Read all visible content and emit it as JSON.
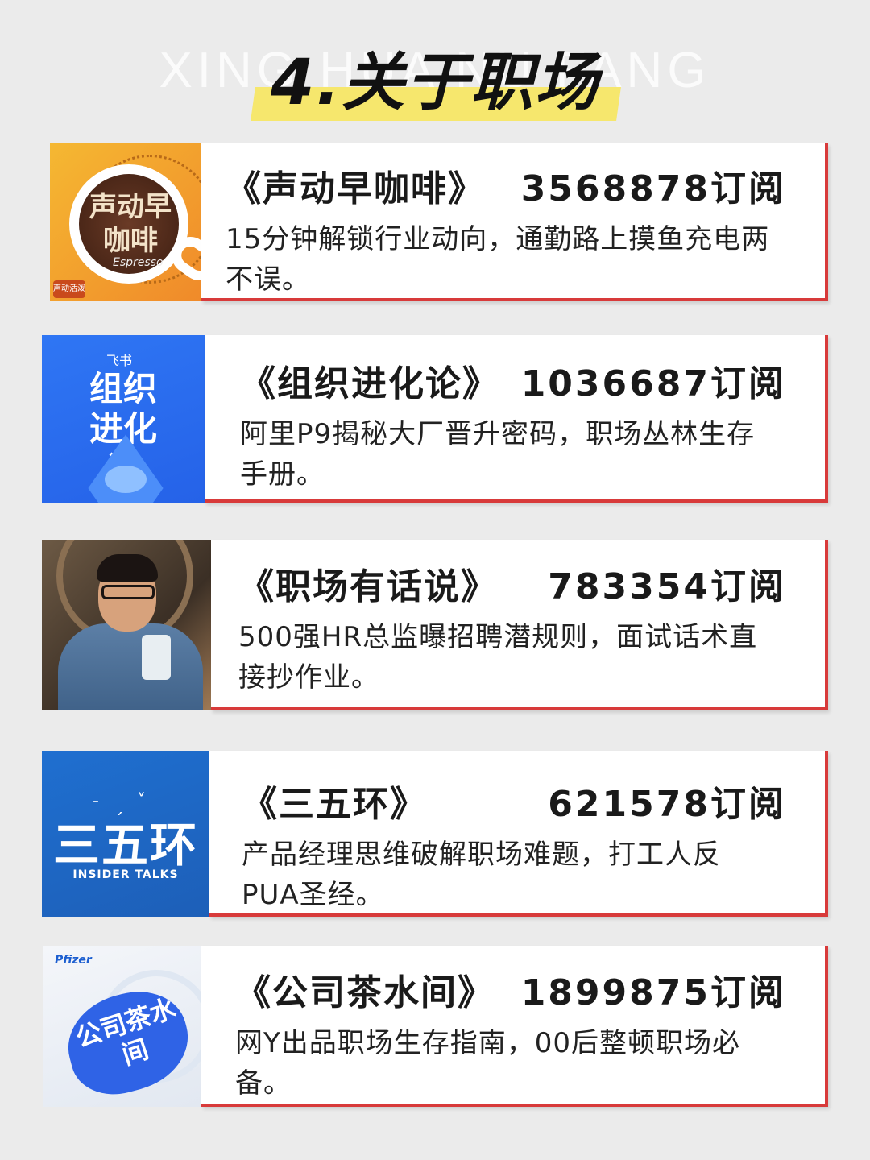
{
  "header": {
    "watermark": "XING HUA NU FANG",
    "title": "4.关于职场"
  },
  "cards": [
    {
      "name": "《声动早咖啡》",
      "subs": "3568878订阅",
      "desc": "15分钟解锁行业动向，通勤路上摸鱼充电两不误。",
      "thumb": {
        "label": "声动早咖啡",
        "sub": "Espresso",
        "brand": "声动活泼"
      }
    },
    {
      "name": "《组织进化论》",
      "subs": "1036687订阅",
      "desc": "阿里P9揭秘大厂晋升密码，职场丛林生存手册。",
      "thumb": {
        "tag": "飞书",
        "label": "组织进化论"
      }
    },
    {
      "name": "《职场有话说》",
      "subs": "783354订阅",
      "desc": "500强HR总监曝招聘潜规则，面试话术直接抄作业。",
      "thumb": {}
    },
    {
      "name": "《三五环》",
      "subs": "621578订阅",
      "desc": "产品经理思维破解职场难题，打工人反PUA圣经。",
      "thumb": {
        "label": "三五环",
        "sub": "INSIDER TALKS"
      }
    },
    {
      "name": "《公司茶水间》",
      "subs": "1899875订阅",
      "desc": "网Y出品职场生存指南，00后整顿职场必备。",
      "thumb": {
        "brand": "Pfizer",
        "label": "公司茶水间"
      }
    }
  ],
  "colors": {
    "accent": "#d83a3a",
    "highlight": "#f6e76d",
    "background": "#ebebeb"
  }
}
